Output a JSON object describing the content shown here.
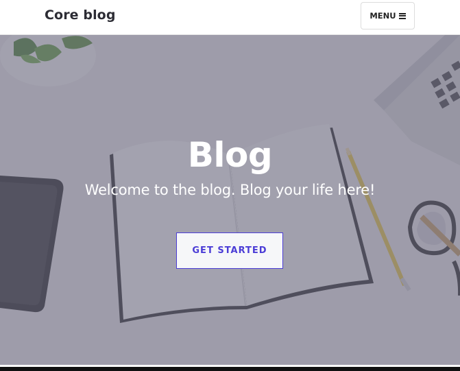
{
  "navbar": {
    "brand": "Core blog",
    "menu_label": "MENU",
    "menu_icon": "hamburger-icon"
  },
  "hero": {
    "title": "Blog",
    "subtitle": "Welcome to the blog. Blog your life here!",
    "cta_label": "GET STARTED",
    "background_image": "desk-with-notebook-phone-pencil-glasses-laptop"
  },
  "colors": {
    "accent": "#4a3cd6",
    "overlay": "#6e6c80",
    "brand_text": "#2c2c34"
  }
}
